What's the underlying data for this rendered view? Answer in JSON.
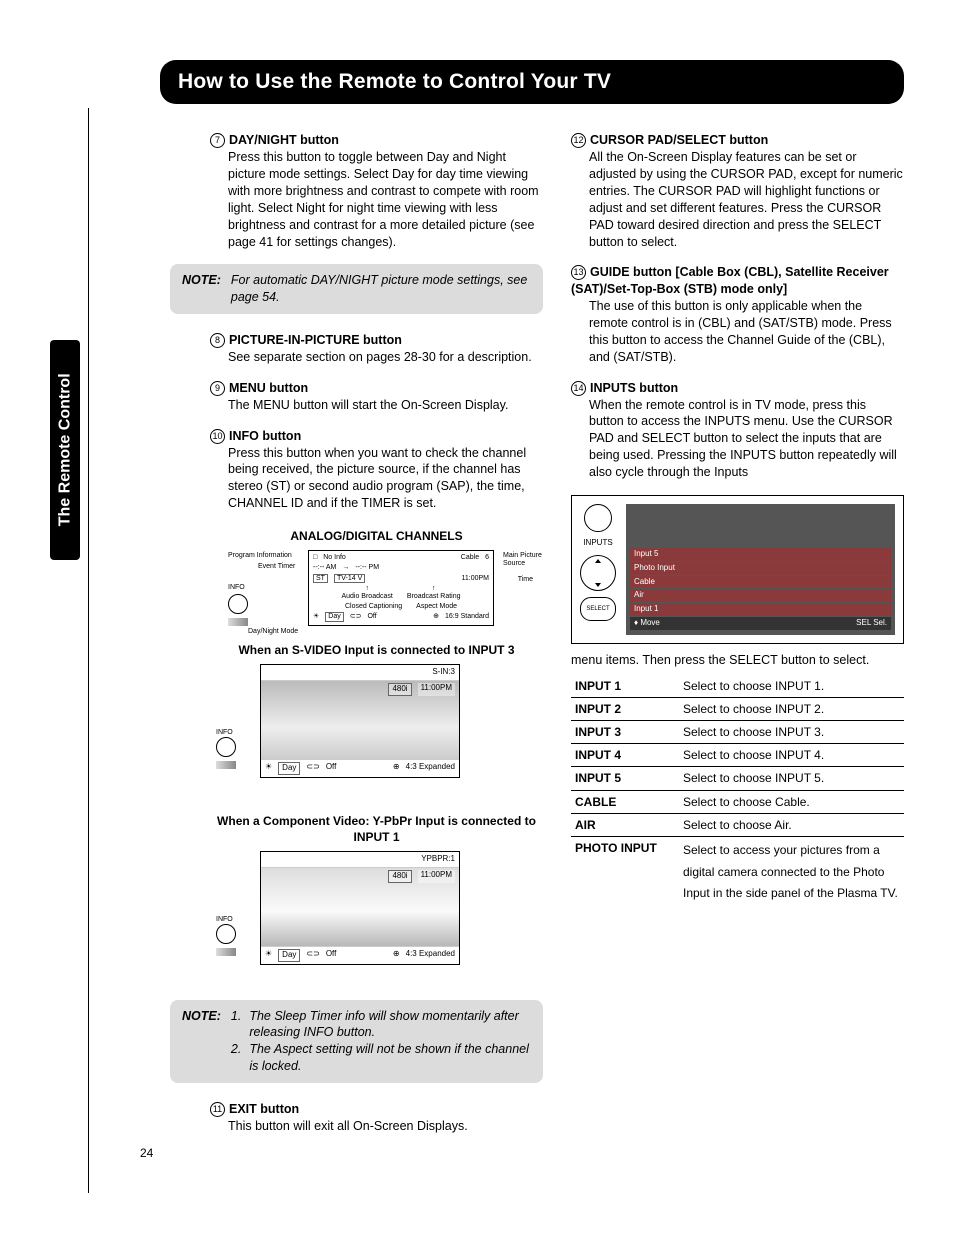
{
  "header": "How to Use the Remote to Control Your TV",
  "side_tab": "The Remote Control",
  "page_number": "24",
  "left": {
    "item7": {
      "num": "7",
      "title": "DAY/NIGHT button",
      "body": "Press this button to toggle between Day and Night picture mode settings.  Select Day for day time viewing with more brightness and contrast to compete with room light.  Select Night for night time viewing with less brightness and contrast for a more detailed picture (see page 41 for settings changes)."
    },
    "note1": {
      "label": "NOTE:",
      "text": "For automatic DAY/NIGHT picture mode settings, see page 54."
    },
    "item8": {
      "num": "8",
      "title": "PICTURE-IN-PICTURE button",
      "body": "See separate section on pages 28-30 for a description."
    },
    "item9": {
      "num": "9",
      "title": "MENU button",
      "body": "The MENU button will start the On-Screen Display."
    },
    "item10": {
      "num": "10",
      "title": "INFO button",
      "body": "Press this button when you want to check the channel being received, the picture source, if the channel has stereo (ST) or second audio program (SAP), the time, CHANNEL ID and if the TIMER is set."
    },
    "analog_title": "ANALOG/DIGITAL CHANNELS",
    "analog_labels": {
      "program_info": "Program Information",
      "event_timer": "Event Timer",
      "info": "INFO",
      "day_night": "Day/Night Mode",
      "audio_broadcast": "Audio Broadcast",
      "broadcast_rating": "Broadcast Rating",
      "closed_captioning": "Closed Captioning",
      "aspect_mode": "Aspect Mode",
      "main_picture": "Main Picture Source",
      "time": "Time"
    },
    "analog_values": {
      "no_info": "No Info",
      "am": "--:-- AM",
      "pm": "--:-- PM",
      "st": "ST",
      "tv14": "TV-14 V",
      "cable": "Cable",
      "channel": "6",
      "clock": "11:00PM",
      "day": "Day",
      "off": "Off",
      "aspect": "16:9 Standard"
    },
    "svideo_title": "When an S-VIDEO Input is connected to INPUT 3",
    "svideo": {
      "corner": "S-IN:3",
      "res": "480i",
      "clock": "11:00PM",
      "day": "Day",
      "off": "Off",
      "aspect": "4:3 Expanded"
    },
    "component_title": "When a Component Video: Y-PbPr Input is connected to INPUT 1",
    "component": {
      "corner": "YPBPR:1",
      "res": "480i",
      "clock": "11:00PM",
      "day": "Day",
      "off": "Off",
      "aspect": "4:3 Expanded"
    },
    "note2": {
      "label": "NOTE:",
      "n1_num": "1.",
      "n1": "The Sleep Timer info will show momentarily after releasing INFO button.",
      "n2_num": "2.",
      "n2": "The Aspect setting will not be shown if the channel is locked."
    },
    "item11": {
      "num": "11",
      "title": "EXIT button",
      "body": "This button will exit all On-Screen Displays."
    }
  },
  "right": {
    "item12": {
      "num": "12",
      "title": "CURSOR PAD/SELECT button",
      "body": "All the On-Screen Display features can be set or adjusted by using the CURSOR PAD, except for numeric entries.  The CURSOR PAD will highlight functions or adjust and set different features.  Press the CURSOR PAD toward desired direction and press the SELECT button to select."
    },
    "item13": {
      "num": "13",
      "title": "GUIDE button [Cable Box (CBL), Satellite Receiver (SAT)/Set-Top-Box (STB) mode only]",
      "body": "The use of this button is only applicable when the remote control is in (CBL) and (SAT/STB) mode.  Press this button to access the Channel Guide of the (CBL), and (SAT/STB)."
    },
    "item14": {
      "num": "14",
      "title": "INPUTS button",
      "body_a": "When the remote control is in TV mode, press this button to access the INPUTS menu.  Use the CURSOR PAD and SELECT button to select the inputs that are being used.  Pressing the INPUTS button repeatedly will also cycle through the Inputs",
      "body_b": "menu items.  Then press the SELECT button to select."
    },
    "inputs_diagram": {
      "label": "INPUTS",
      "select": "SELECT",
      "rows": [
        "Input 5",
        "Photo Input",
        "Cable",
        "Air",
        "Input 1"
      ],
      "move": "Move",
      "sel": "SEL Sel."
    },
    "inputs_table": [
      {
        "k": "INPUT 1",
        "v": "Select to choose INPUT 1."
      },
      {
        "k": "INPUT 2",
        "v": "Select to choose INPUT 2."
      },
      {
        "k": "INPUT 3",
        "v": "Select to choose INPUT 3."
      },
      {
        "k": "INPUT 4",
        "v": "Select to choose INPUT 4."
      },
      {
        "k": "INPUT 5",
        "v": "Select to choose INPUT 5."
      },
      {
        "k": "CABLE",
        "v": "Select to choose Cable."
      },
      {
        "k": "AIR",
        "v": "Select to choose Air."
      }
    ],
    "photo_input": {
      "k": "PHOTO INPUT",
      "v": "Select to access your pictures from a digital camera connected to the Photo Input in the side panel of the Plasma TV."
    }
  }
}
